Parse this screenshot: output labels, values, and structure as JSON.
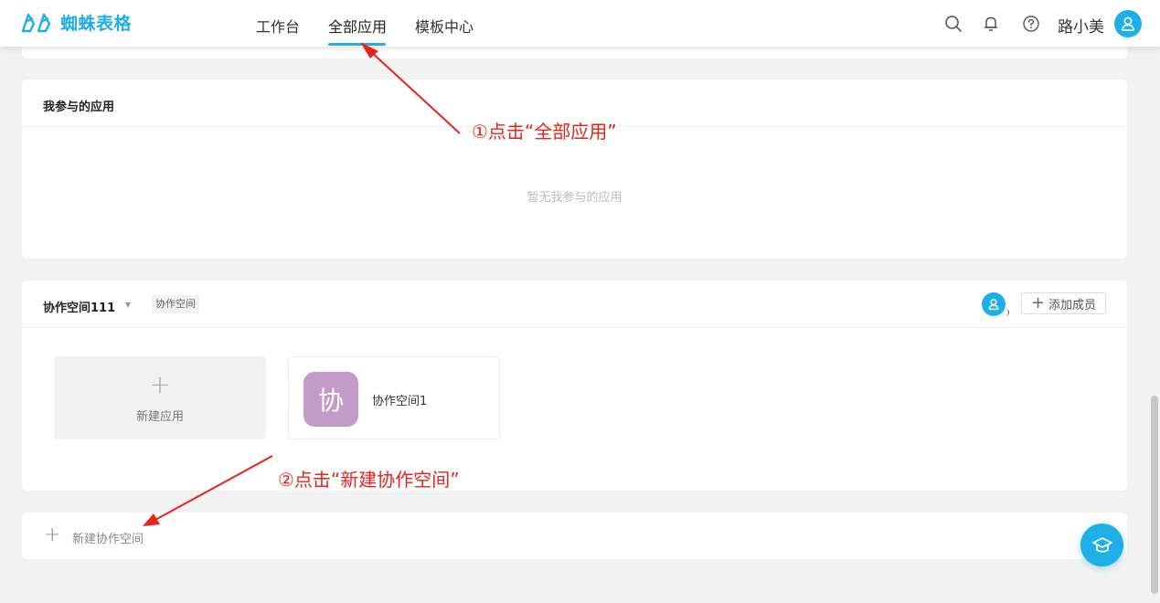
{
  "header": {
    "logo_text": "蜘蛛表格",
    "nav": [
      {
        "label": "工作台"
      },
      {
        "label": "全部应用"
      },
      {
        "label": "模板中心"
      }
    ],
    "user_name": "路小美"
  },
  "apps_section": {
    "title": "我参与的应用",
    "empty_text": "暂无我参与的应用"
  },
  "space": {
    "name": "协作空间111",
    "tag": "协作空间",
    "add_member_label": "添加成员",
    "new_app_label": "新建应用",
    "app": {
      "icon_char": "协",
      "name": "协作空间1"
    }
  },
  "new_space": {
    "label": "新建协作空间"
  },
  "annotations": {
    "step1": "①点击“全部应用”",
    "step2": "②点击“新建协作空间”"
  },
  "colors": {
    "accent": "#1eaee8",
    "app_icon": "#c49ac8",
    "annotation": "#e8231c"
  }
}
